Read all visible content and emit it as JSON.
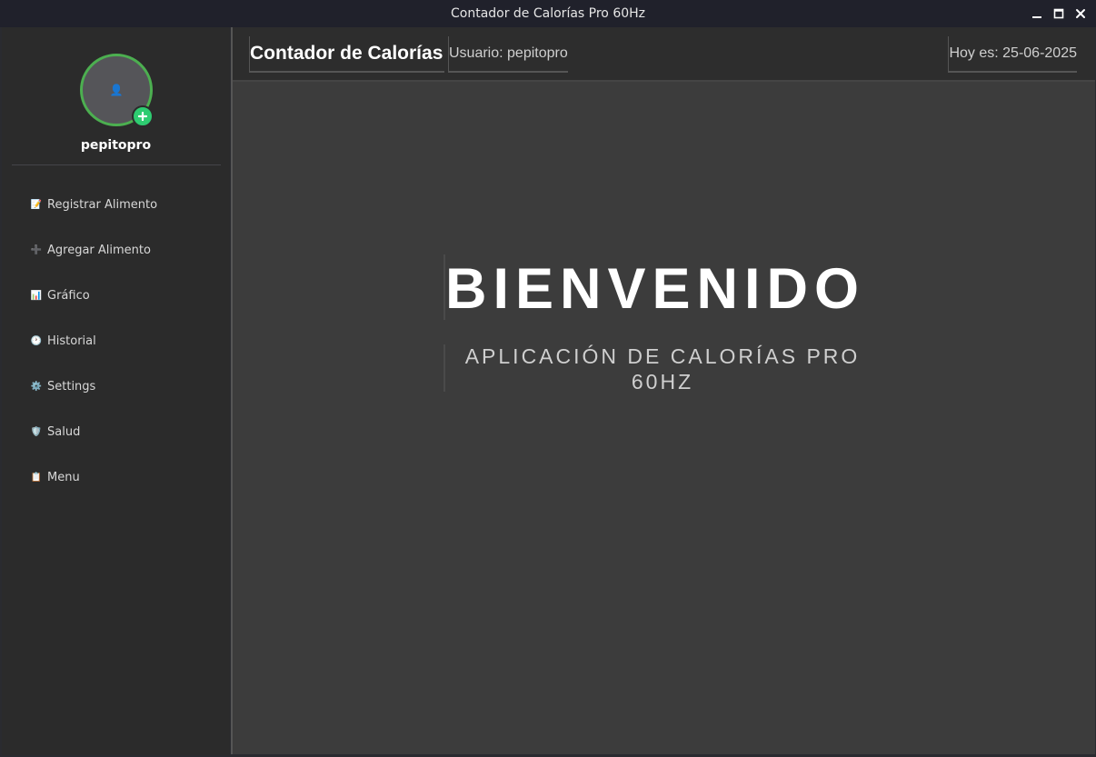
{
  "window": {
    "title": "Contador de Calorías Pro 60Hz"
  },
  "sidebar": {
    "username": "pepitopro",
    "avatar_icon": "user-icon",
    "items": [
      {
        "label": "Registrar Alimento",
        "icon": "memo-icon",
        "glyph": "📝"
      },
      {
        "label": "Agregar Alimento",
        "icon": "plus-icon",
        "glyph": "➕"
      },
      {
        "label": "Gráfico",
        "icon": "bar-chart-icon",
        "glyph": "📊"
      },
      {
        "label": "Historial",
        "icon": "clock-icon",
        "glyph": "🕐"
      },
      {
        "label": "Settings",
        "icon": "gear-icon",
        "glyph": "⚙️"
      },
      {
        "label": "Salud",
        "icon": "shield-icon",
        "glyph": "🛡️"
      },
      {
        "label": "Menu",
        "icon": "clipboard-icon",
        "glyph": "📋"
      }
    ]
  },
  "header": {
    "app_title": "Contador de Calorías",
    "user_label": "Usuario: pepitopro",
    "date_label": "Hoy es: 25-06-2025"
  },
  "welcome": {
    "title": "BIENVENIDO",
    "subtitle": "APLICACIÓN DE CALORÍAS PRO 60HZ"
  },
  "colors": {
    "accent_green": "#4caf50",
    "add_button_green": "#2ecc71",
    "sidebar_bg": "#2b2b2b",
    "main_bg": "#3c3c3c",
    "titlebar_bg": "#20212b"
  }
}
